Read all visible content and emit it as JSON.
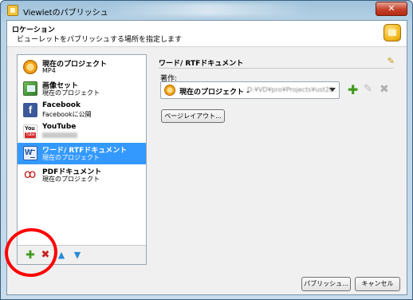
{
  "window": {
    "title": "Viewletのパブリッシュ",
    "close_label": "✕"
  },
  "header": {
    "title": "ロケーション",
    "subtitle": "ビューレットをパブリッシュする場所を指定します"
  },
  "locations": [
    {
      "title": "現在のプロジェクト",
      "subtitle": "MP4",
      "icon": "project-icon"
    },
    {
      "title": "画像セット",
      "subtitle": "現在のプロジェクト",
      "icon": "image-set-icon"
    },
    {
      "title": "Facebook",
      "subtitle": "Facebookに公開",
      "icon": "facebook-icon"
    },
    {
      "title": "YouTube",
      "subtitle": "",
      "icon": "youtube-icon"
    },
    {
      "title": "ワード/ RTFドキュメント",
      "subtitle": "現在のプロジェクト",
      "icon": "word-icon",
      "selected": true
    },
    {
      "title": "PDFドキュメント",
      "subtitle": "現在のプロジェクト",
      "icon": "pdf-icon"
    }
  ],
  "list_toolbar": {
    "add": "✚",
    "delete": "✖",
    "up": "▲",
    "down": "▼"
  },
  "detail": {
    "title": "ワード/ RTFドキュメント",
    "edit_glyph": "✎",
    "author_label": "著作:",
    "author_value": "現在のプロジェクト -",
    "author_path": "D:¥VD¥pro¥Projects¥ust20..",
    "add_glyph": "✚",
    "edit_action_glyph": "✎",
    "delete_glyph": "✖",
    "page_layout_button": "ページレイアウト..."
  },
  "buttons": {
    "publish": "パブリッシュ...",
    "cancel": "キャンセル"
  },
  "colors": {
    "selection": "#3399ff",
    "annotation": "#ff0000"
  }
}
